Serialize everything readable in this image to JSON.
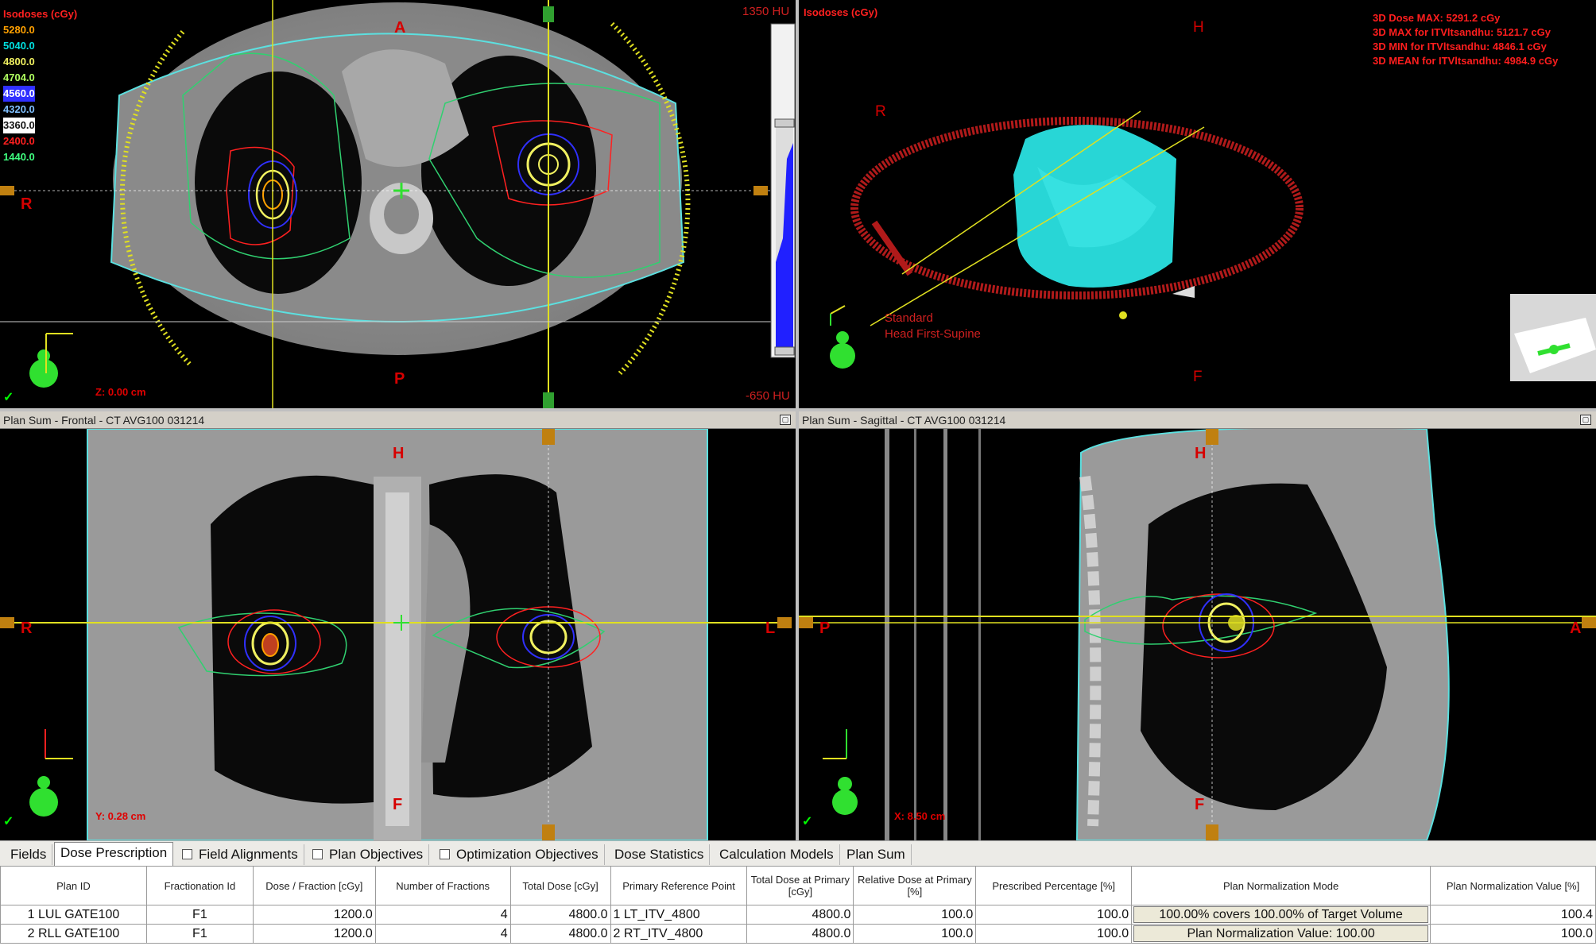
{
  "axial": {
    "legend_title": "Isodoses (cGy)",
    "isodoses": [
      {
        "value": "5280.0",
        "color": "#ffa000"
      },
      {
        "value": "5040.0",
        "color": "#00e0e0"
      },
      {
        "value": "4800.0",
        "color": "#f0f060"
      },
      {
        "value": "4704.0",
        "color": "#b0ff60"
      },
      {
        "value": "4560.0",
        "color": "#3030ff"
      },
      {
        "value": "4320.0",
        "color": "#80c0ff"
      },
      {
        "value": "3360.0",
        "color": "#ffffff"
      },
      {
        "value": "2400.0",
        "color": "#ff2020"
      },
      {
        "value": "1440.0",
        "color": "#40ff80"
      }
    ],
    "hu_top": "1350 HU",
    "hu_bottom": "-650 HU",
    "label_a": "A",
    "label_p": "P",
    "label_r": "R",
    "z_coord": "Z: 0.00 cm"
  },
  "view3d": {
    "legend_title": "Isodoses (cGy)",
    "label_h": "H",
    "label_r": "R",
    "label_f": "F",
    "stats": [
      "3D Dose MAX: 5291.2 cGy",
      "3D MAX for ITVltsandhu: 5121.7 cGy",
      "3D MIN for ITVltsandhu: 4846.1 cGy",
      "3D MEAN for ITVltsandhu: 4984.9 cGy"
    ],
    "orientation_line1": "Standard",
    "orientation_line2": "Head First-Supine"
  },
  "frontal": {
    "title": "Plan Sum - Frontal - CT AVG100 031214",
    "label_h": "H",
    "label_f": "F",
    "label_r": "R",
    "label_l": "L",
    "y_coord": "Y: 0.28 cm"
  },
  "sagittal": {
    "title": "Plan Sum - Sagittal - CT AVG100 031214",
    "label_h": "H",
    "label_f": "F",
    "label_p": "P",
    "label_a": "A",
    "x_coord": "X: 8.50 cm"
  },
  "tabs": {
    "fields": "Fields",
    "dose_prescription": "Dose Prescription",
    "field_alignments": "Field Alignments",
    "plan_objectives": "Plan Objectives",
    "optimization_objectives": "Optimization Objectives",
    "dose_statistics": "Dose Statistics",
    "calculation_models": "Calculation Models",
    "plan_sum": "Plan Sum"
  },
  "table": {
    "headers": {
      "plan_id": "Plan ID",
      "fraction_id": "Fractionation Id",
      "dose_fraction": "Dose / Fraction [cGy]",
      "num_fractions": "Number of Fractions",
      "total_dose": "Total Dose [cGy]",
      "primary_ref": "Primary Reference Point",
      "total_primary": "Total Dose at Primary [cGy]",
      "relative_primary": "Relative Dose at Primary [%]",
      "prescribed_pct": "Prescribed Percentage [%]",
      "norm_mode": "Plan Normalization Mode",
      "norm_value": "Plan Normalization Value [%]"
    },
    "rows": [
      {
        "plan_id": "1 LUL GATE100",
        "fraction_id": "F1",
        "dose_fraction": "1200.0",
        "num_fractions": "4",
        "total_dose": "4800.0",
        "primary_ref": "1 LT_ITV_4800",
        "total_primary": "4800.0",
        "relative_primary": "100.0",
        "prescribed_pct": "100.0",
        "norm_mode": "100.00% covers 100.00% of Target Volume",
        "norm_value": "100.4"
      },
      {
        "plan_id": "2 RLL GATE100",
        "fraction_id": "F1",
        "dose_fraction": "1200.0",
        "num_fractions": "4",
        "total_dose": "4800.0",
        "primary_ref": "2 RT_ITV_4800",
        "total_primary": "4800.0",
        "relative_primary": "100.0",
        "prescribed_pct": "100.0",
        "norm_mode": "Plan Normalization Value: 100.00",
        "norm_value": "100.0"
      }
    ]
  }
}
